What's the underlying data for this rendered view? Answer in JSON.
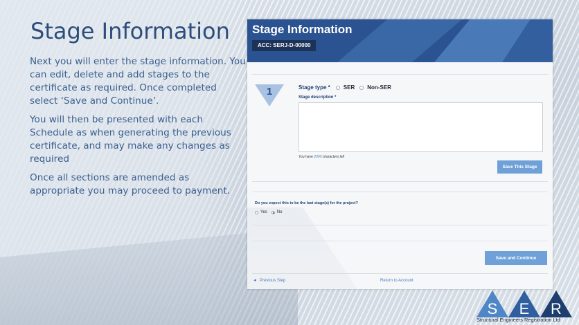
{
  "slide": {
    "title": "Stage Information",
    "paragraphs": [
      "Next you will enter the stage information. You can edit, delete and add stages to the certificate as required. Once completed select ‘Save and Continue’.",
      "You will then be presented with each Schedule as when generating the previous certificate, and may make any changes as required",
      "Once all sections are amended as appropriate you may proceed to payment."
    ]
  },
  "panel": {
    "title": "Stage Information",
    "acc_badge": "ACC: SERJ-D-00000",
    "stage_number": "1",
    "stage_type_label": "Stage type *",
    "stage_type_options": [
      "SER",
      "Non-SER"
    ],
    "stage_description_label": "Stage description *",
    "stage_description_value": "",
    "chars_left_prefix": "You have ",
    "chars_left_count": "2000",
    "chars_left_suffix": " characters left",
    "save_stage_label": "Save This Stage",
    "last_stage_question": "Do you expect this to be the last stage(s) for the project?",
    "last_stage_options": [
      "Yes",
      "No"
    ],
    "last_stage_selected": "No",
    "save_continue_label": "Save and Continue",
    "previous_step_label": "Previous Step",
    "return_account_label": "Return to Account"
  },
  "logo": {
    "letters": [
      "S",
      "E",
      "R"
    ],
    "caption": "Structural Engineers Registration Ltd"
  },
  "colors": {
    "header_blue": "#2b5291",
    "button_blue": "#6fa1d8",
    "title_text": "#2d4d7a",
    "body_text": "#3b5f8f",
    "link_blue": "#4a7cc0"
  }
}
